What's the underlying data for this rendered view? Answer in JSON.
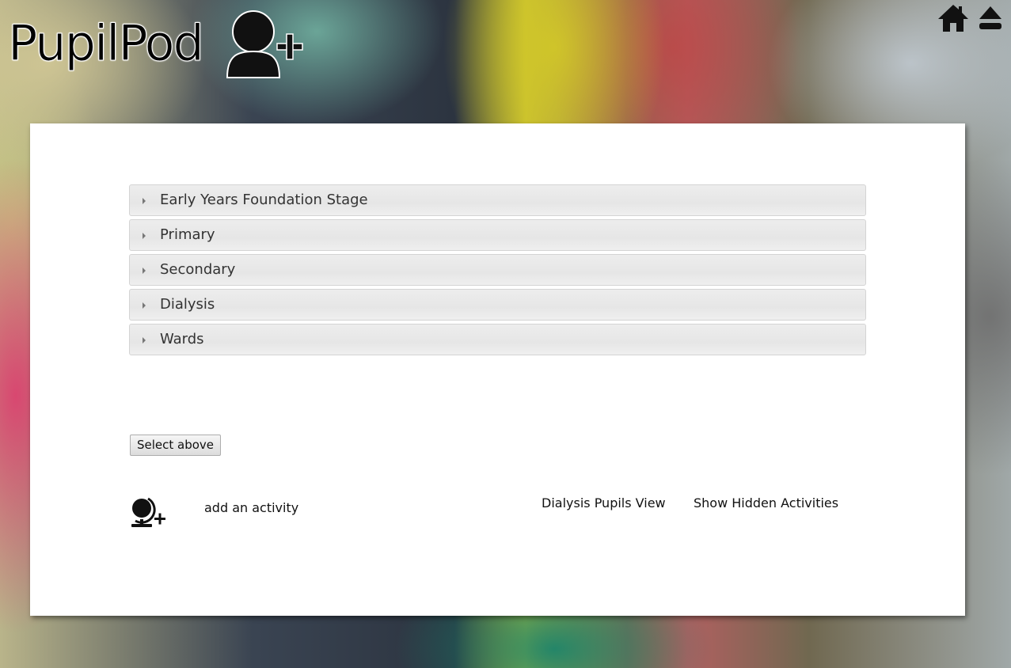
{
  "header": {
    "logo_text": "PupilPod",
    "logo_icon": "add-user-icon",
    "home_icon": "home-icon",
    "eject_icon": "eject-icon"
  },
  "accordion": {
    "items": [
      {
        "label": "Early Years Foundation Stage"
      },
      {
        "label": "Primary"
      },
      {
        "label": "Secondary"
      },
      {
        "label": "Dialysis"
      },
      {
        "label": "Wards"
      }
    ]
  },
  "controls": {
    "select_button": "Select above",
    "add_activity": "add an activity",
    "dialysis_view": "Dialysis Pupils View",
    "show_hidden": "Show Hidden Activities"
  }
}
